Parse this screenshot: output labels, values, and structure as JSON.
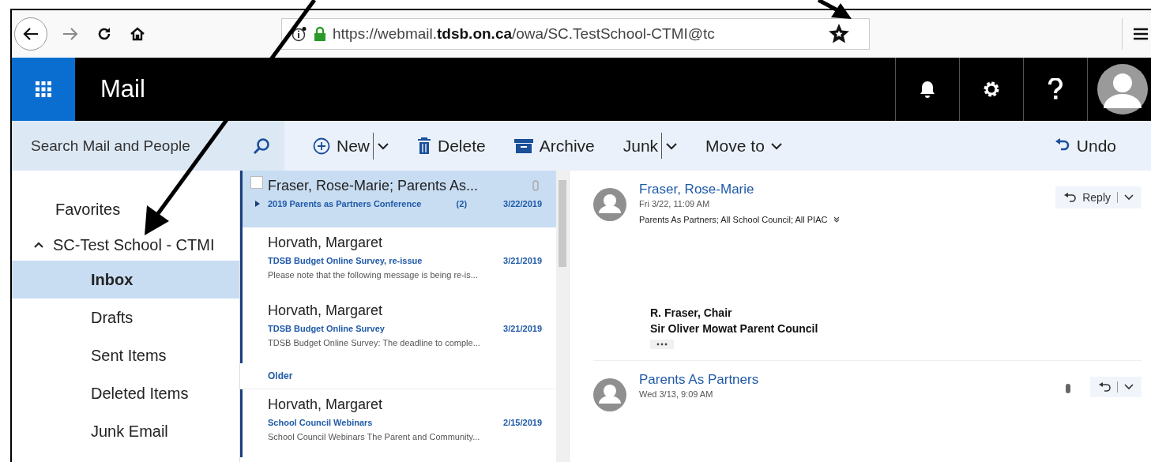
{
  "browser": {
    "url": "https://webmail.**tdsb.on.ca**/owa/SC.TestSchool-CTMI@tc"
  },
  "header": {
    "app_title": "Mail"
  },
  "search": {
    "placeholder": "Search Mail and People"
  },
  "toolbar": {
    "new": {
      "label": "New"
    },
    "delete": {
      "label": "Delete"
    },
    "archive": {
      "label": "Archive"
    },
    "junk": {
      "label": "Junk"
    },
    "move_to": {
      "label": "Move to"
    },
    "undo": {
      "label": "Undo"
    }
  },
  "sidebar": {
    "favorites": "Favorites",
    "account": {
      "label": "SC-Test School - CTMI",
      "expanded": true,
      "children": [
        {
          "label": "Inbox",
          "selected": true
        },
        {
          "label": "Drafts",
          "selected": false
        },
        {
          "label": "Sent Items",
          "selected": false
        },
        {
          "label": "Deleted Items",
          "selected": false
        },
        {
          "label": "Junk Email",
          "selected": false
        }
      ]
    }
  },
  "message_list": [
    {
      "kind": "message",
      "sender": "Fraser, Rose-Marie; Parents As...",
      "subject": "2019 Parents as Partners Conference",
      "count": "(2)",
      "date": "3/22/2019",
      "selected": true,
      "unread": true,
      "attachment": true,
      "thread": true
    },
    {
      "kind": "message",
      "sender": "Horvath, Margaret",
      "subject": "TDSB Budget Online Survey, re-issue",
      "date": "3/21/2019",
      "preview": "Please note that the following message is being re-is...",
      "selected": false,
      "unread": true,
      "attachment": false,
      "thread": false
    },
    {
      "kind": "message",
      "sender": "Horvath, Margaret",
      "subject": "TDSB Budget Online Survey",
      "date": "3/21/2019",
      "preview": "TDSB Budget Online Survey: The deadline to comple...",
      "selected": false,
      "unread": true,
      "attachment": false,
      "thread": false
    },
    {
      "kind": "group",
      "label": "Older"
    },
    {
      "kind": "message",
      "sender": "Horvath, Margaret",
      "subject": "School Council Webinars",
      "date": "2/15/2019",
      "preview": "School Council Webinars The Parent and Community...",
      "selected": false,
      "unread": true,
      "attachment": false,
      "thread": false
    }
  ],
  "reading_pane": [
    {
      "sender": "Fraser, Rose-Marie",
      "date": "Fri 3/22, 11:09 AM",
      "recipients": "Parents As Partners; All School Council; All PIAC",
      "reply_label": "Reply",
      "attachment": false,
      "signature": [
        "R. Fraser, Chair",
        "Sir Oliver Mowat Parent Council"
      ]
    },
    {
      "sender": "Parents As Partners",
      "date": "Wed 3/13, 9:09 AM",
      "attachment": true
    }
  ]
}
